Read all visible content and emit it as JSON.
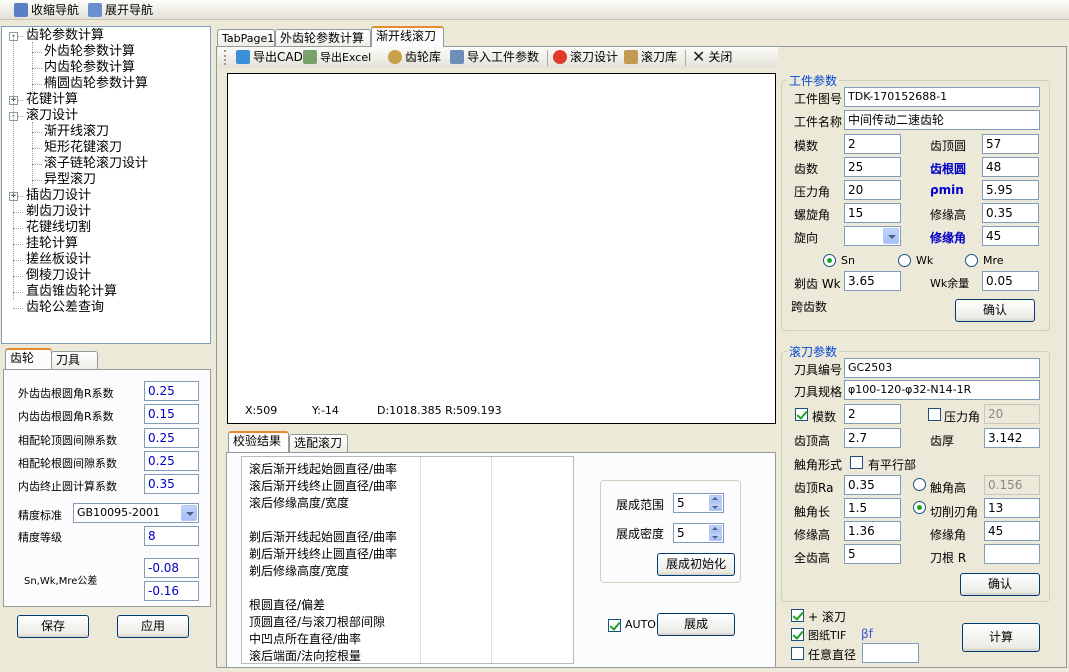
{
  "topbar": {
    "collapse_nav": "收缩导航",
    "expand_nav": "展开导航"
  },
  "tree": [
    {
      "label": "齿轮参数计算",
      "level": 0,
      "box": "-"
    },
    {
      "label": "外齿轮参数计算",
      "level": 1
    },
    {
      "label": "内齿轮参数计算",
      "level": 1
    },
    {
      "label": "椭圆齿轮参数计算",
      "level": 1
    },
    {
      "label": "花键计算",
      "level": 0,
      "box": "+"
    },
    {
      "label": "滚刀设计",
      "level": 0,
      "box": "-"
    },
    {
      "label": "渐开线滚刀",
      "level": 1
    },
    {
      "label": "矩形花键滚刀",
      "level": 1
    },
    {
      "label": "滚子链轮滚刀设计",
      "level": 1
    },
    {
      "label": "异型滚刀",
      "level": 1
    },
    {
      "label": "插齿刀设计",
      "level": 0,
      "box": "+"
    },
    {
      "label": "剃齿刀设计",
      "level": 0
    },
    {
      "label": "花键线切割",
      "level": 0
    },
    {
      "label": "挂轮计算",
      "level": 0
    },
    {
      "label": "搓丝板设计",
      "level": 0
    },
    {
      "label": "倒棱刀设计",
      "level": 0
    },
    {
      "label": "直齿锥齿轮计算",
      "level": 0
    },
    {
      "label": "齿轮公差查询",
      "level": 0
    }
  ],
  "left_tabs": {
    "gear": "齿轮",
    "tool": "刀具"
  },
  "left_params": {
    "ext_root_r": {
      "label": "外齿齿根圆角R系数",
      "value": "0.25"
    },
    "int_root_r": {
      "label": "内齿齿根圆角R系数",
      "value": "0.15"
    },
    "tip_gap": {
      "label": "相配轮顶圆间隙系数",
      "value": "0.25"
    },
    "root_gap": {
      "label": "相配轮根圆间隙系数",
      "value": "0.25"
    },
    "int_end": {
      "label": "内齿终止圆计算系数",
      "value": "0.35"
    },
    "precision_std": {
      "label": "精度标准",
      "value": "GB10095-2001"
    },
    "precision_grade": {
      "label": "精度等级",
      "value": "8"
    },
    "tolerance": {
      "label": "Sn,Wk,Mre公差",
      "upper": "-0.08",
      "lower": "-0.16"
    }
  },
  "left_buttons": {
    "save": "保存",
    "apply": "应用"
  },
  "main_tabs": {
    "tab1": "TabPage1",
    "tab2": "外齿轮参数计算",
    "tab3": "渐开线滚刀"
  },
  "toolbar": {
    "export_cad": "导出CAD",
    "export_excel": "导出Excel",
    "gear_lib": "齿轮库",
    "import_params": "导入工件参数",
    "hob_design": "滚刀设计",
    "hob_lib": "滚刀库",
    "close": "关闭"
  },
  "canvas_status": {
    "x": "X:509",
    "y": "Y:-14",
    "d": "D:1018.385 R:509.193"
  },
  "check_tabs": {
    "result": "校验结果",
    "select": "选配滚刀"
  },
  "check_rows": [
    "滚后渐开线起始圆直径/曲率",
    "滚后渐开线终止圆直径/曲率",
    "滚后修缘高度/宽度",
    "",
    "剃后渐开线起始圆直径/曲率",
    "剃后渐开线终止圆直径/曲率",
    "剃后修缘高度/宽度",
    "",
    "根圆直径/偏差",
    "顶圆直径/与滚刀根部间隙",
    "中凹点所在直径/曲率",
    "滚后端面/法向挖根量"
  ],
  "expand": {
    "range_label": "展成范围",
    "range_value": "5",
    "density_label": "展成密度",
    "density_value": "5",
    "init_button": "展成初始化",
    "auto_label": "AUTO",
    "expand_button": "展成"
  },
  "workpiece": {
    "title": "工件参数",
    "drawing_no_label": "工件图号",
    "drawing_no": "TDK-170152688-1",
    "name_label": "工件名称",
    "name": "中间传动二速齿轮",
    "module_label": "模数",
    "module": "2",
    "tip_label": "齿顶圆",
    "tip": "57",
    "teeth_label": "齿数",
    "teeth": "25",
    "root_label": "齿根圆",
    "root": "48",
    "pressure_label": "压力角",
    "pressure": "20",
    "rho_label": "ρmin",
    "rho": "5.95",
    "helix_label": "螺旋角",
    "helix": "15",
    "mod_height_label": "修缘高",
    "mod_height": "0.35",
    "direction_label": "旋向",
    "mod_angle_label": "修缘角",
    "mod_angle": "45",
    "radio_sn": "Sn",
    "radio_wk": "Wk",
    "radio_mre": "Mre",
    "shave_wk_label": "剃齿 Wk",
    "shave_wk": "3.65",
    "wk_margin_label": "Wk余量",
    "wk_margin": "0.05",
    "span_label": "跨齿数",
    "confirm": "确认"
  },
  "hob": {
    "title": "滚刀参数",
    "code_label": "刀具编号",
    "code": "GC2503",
    "spec_label": "刀具规格",
    "spec": "φ100-120-φ32-N14-1R",
    "module_label": "模数",
    "module": "2",
    "pressure_label": "压力角",
    "pressure": "20",
    "tip_label": "齿顶高",
    "tip": "2.7",
    "thickness_label": "齿厚",
    "thickness": "3.142",
    "protuberance_label": "触角形式",
    "parallel_label": "有平行部",
    "tip_ra_label": "齿顶Ra",
    "tip_ra": "0.35",
    "prot_angle_label": "触角高",
    "prot_angle": "0.156",
    "prot_len_label": "触角长",
    "prot_len": "1.5",
    "cut_angle_label": "切削刃角",
    "cut_angle": "13",
    "mod_height_label": "修缘高",
    "mod_height": "1.36",
    "mod_angle_label": "修缘角",
    "mod_angle": "45",
    "full_depth_label": "全齿高",
    "full_depth": "5",
    "root_r_label": "刀根 R",
    "root_r": "",
    "confirm": "确认"
  },
  "bottom_right": {
    "plus_hob": "+ 滚刀",
    "drawing_tif": "图纸TIF",
    "beta": "βf",
    "any_dia": "任意直径",
    "any_dia_value": "",
    "calc": "计算"
  },
  "colors": {
    "accent": "#e68b2c",
    "label_blue": "#0000c8",
    "group_title": "#0046d5"
  }
}
